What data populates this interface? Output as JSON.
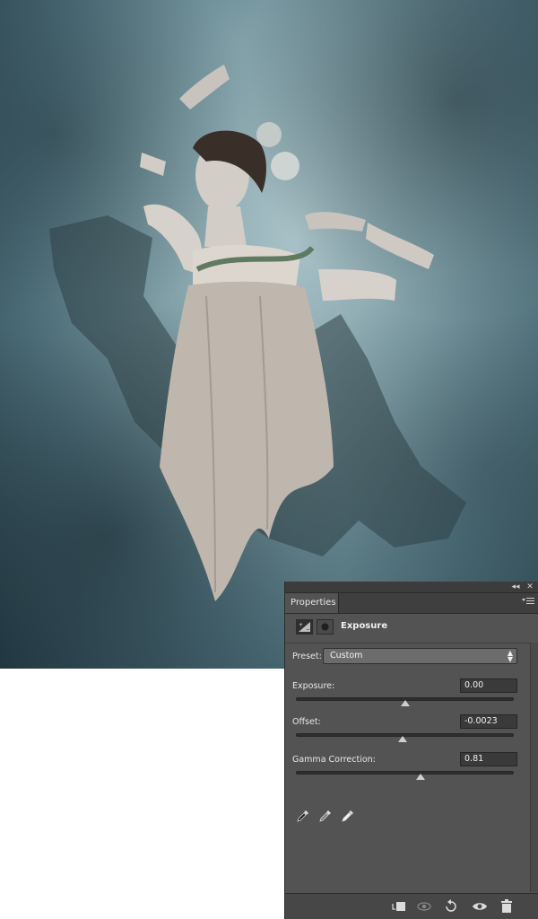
{
  "panel": {
    "tab_label": "Properties",
    "adjustment_title": "Exposure",
    "preset": {
      "label": "Preset:",
      "value": "Custom"
    },
    "exposure": {
      "label": "Exposure:",
      "value": "0.00",
      "slider_fraction": 0.5
    },
    "offset": {
      "label": "Offset:",
      "value": "-0.0023",
      "slider_fraction": 0.49
    },
    "gamma": {
      "label": "Gamma Correction:",
      "value": "0.81",
      "slider_fraction": 0.57
    },
    "topbar_icons": [
      "collapse-icon",
      "close-icon"
    ],
    "menu_icon": "panel-menu-icon",
    "eyedroppers": [
      "black-point-eyedropper-icon",
      "gray-point-eyedropper-icon",
      "white-point-eyedropper-icon"
    ],
    "bottom_icons": [
      "clip-to-layer-icon",
      "view-previous-state-icon",
      "reset-icon",
      "visibility-icon",
      "delete-icon"
    ]
  }
}
